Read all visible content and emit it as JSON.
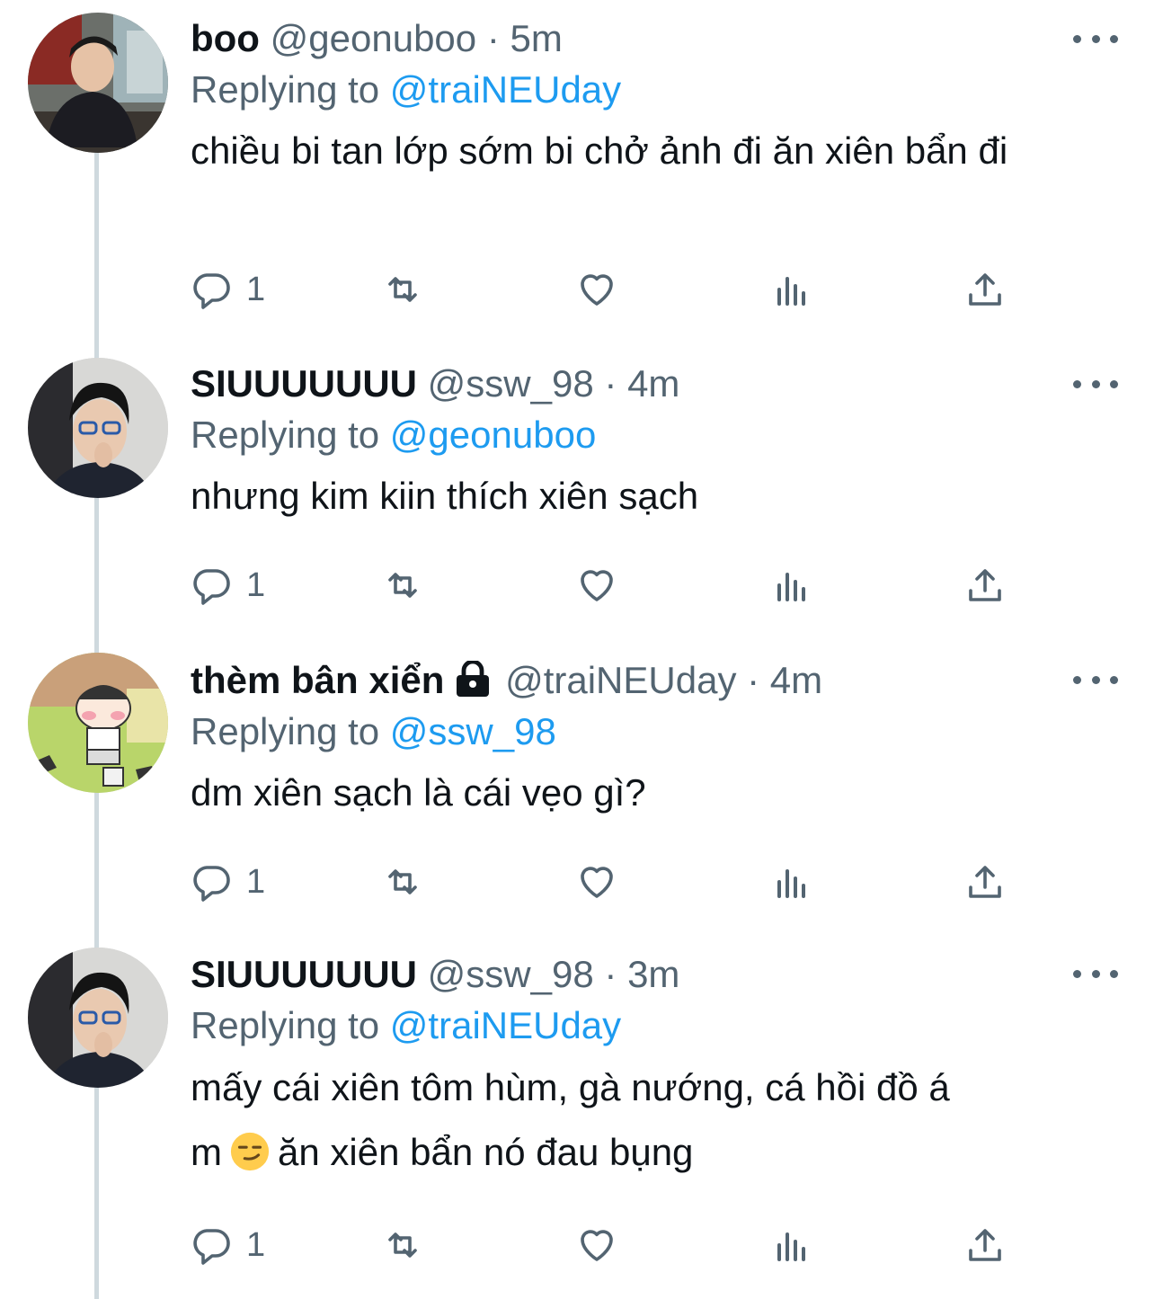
{
  "tweets": [
    {
      "name": "boo",
      "handle": "@geonuboo",
      "sep": "·",
      "time": "5m",
      "replying_prefix": "Replying to",
      "replying_to": "@traiNEUday",
      "text": "chiều bi tan lớp sớm bi chở ảnh đi ăn xiên bẩn đi",
      "reply_count": "1",
      "avatar": "photo-boy-eating-icon"
    },
    {
      "name": "SIUUUUUUU",
      "handle": "@ssw_98",
      "sep": "·",
      "time": "4m",
      "replying_prefix": "Replying to",
      "replying_to": "@geonuboo",
      "text": "nhưng kim kiin thích xiên sạch",
      "reply_count": "1",
      "avatar": "photo-boy-glasses-icon"
    },
    {
      "name": "thèm bân xiển",
      "handle": "@traiNEUday",
      "sep": "·",
      "time": "4m",
      "replying_prefix": "Replying to",
      "replying_to": "@ssw_98",
      "text": "dm xiên sạch là cái vẹo gì?",
      "reply_count": "1",
      "avatar": "cartoon-character-icon",
      "protected": true
    },
    {
      "name": "SIUUUUUUU",
      "handle": "@ssw_98",
      "sep": "·",
      "time": "3m",
      "replying_prefix": "Replying to",
      "replying_to": "@traiNEUday",
      "text_line1": "mấy cái xiên tôm hùm, gà nướng, cá hồi đồ á",
      "text_line2_a": "m",
      "text_line2_b": "ăn xiên bẩn nó đau bụng",
      "reply_count": "1",
      "avatar": "photo-boy-glasses-icon",
      "emoji": "smirking-face-icon"
    }
  ],
  "colors": {
    "text": "#0f1419",
    "secondary": "#536471",
    "link": "#1d9bf0",
    "thread_line": "#cfd9de"
  }
}
